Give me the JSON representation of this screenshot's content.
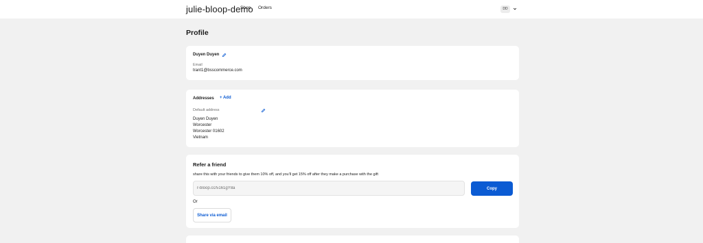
{
  "header": {
    "store_name": "julie-bloop-demo",
    "nav": [
      {
        "label": "Shop"
      },
      {
        "label": "Orders"
      }
    ],
    "account": {
      "initials": "DD",
      "menu_icon": "chevron-down-icon"
    }
  },
  "page": {
    "title": "Profile"
  },
  "profile": {
    "name": "Duyen Duyen",
    "edit_icon": "pencil-icon",
    "email_label": "Email",
    "email_value": "trant1@bsscommerce.com"
  },
  "addresses": {
    "title": "Addresses",
    "add_label": "+ Add",
    "default_label": "Default address",
    "edit_icon": "pencil-icon",
    "lines": [
      "Duyen Duyen",
      "Worcester",
      "Worcester 01602",
      "Vietnam"
    ]
  },
  "refer": {
    "title": "Refer a friend",
    "description": "share this with your friends to give them 10% off, and you'll get 15% off after they make a purchase with the gift",
    "link_value": "r-bloop.cc/5161gY8a",
    "copy_label": "Copy",
    "or_label": "Or",
    "share_email_label": "Share via email"
  },
  "colors": {
    "accent": "#0b5bd3",
    "page_bg": "#f1f1f1",
    "card_bg": "#ffffff"
  }
}
